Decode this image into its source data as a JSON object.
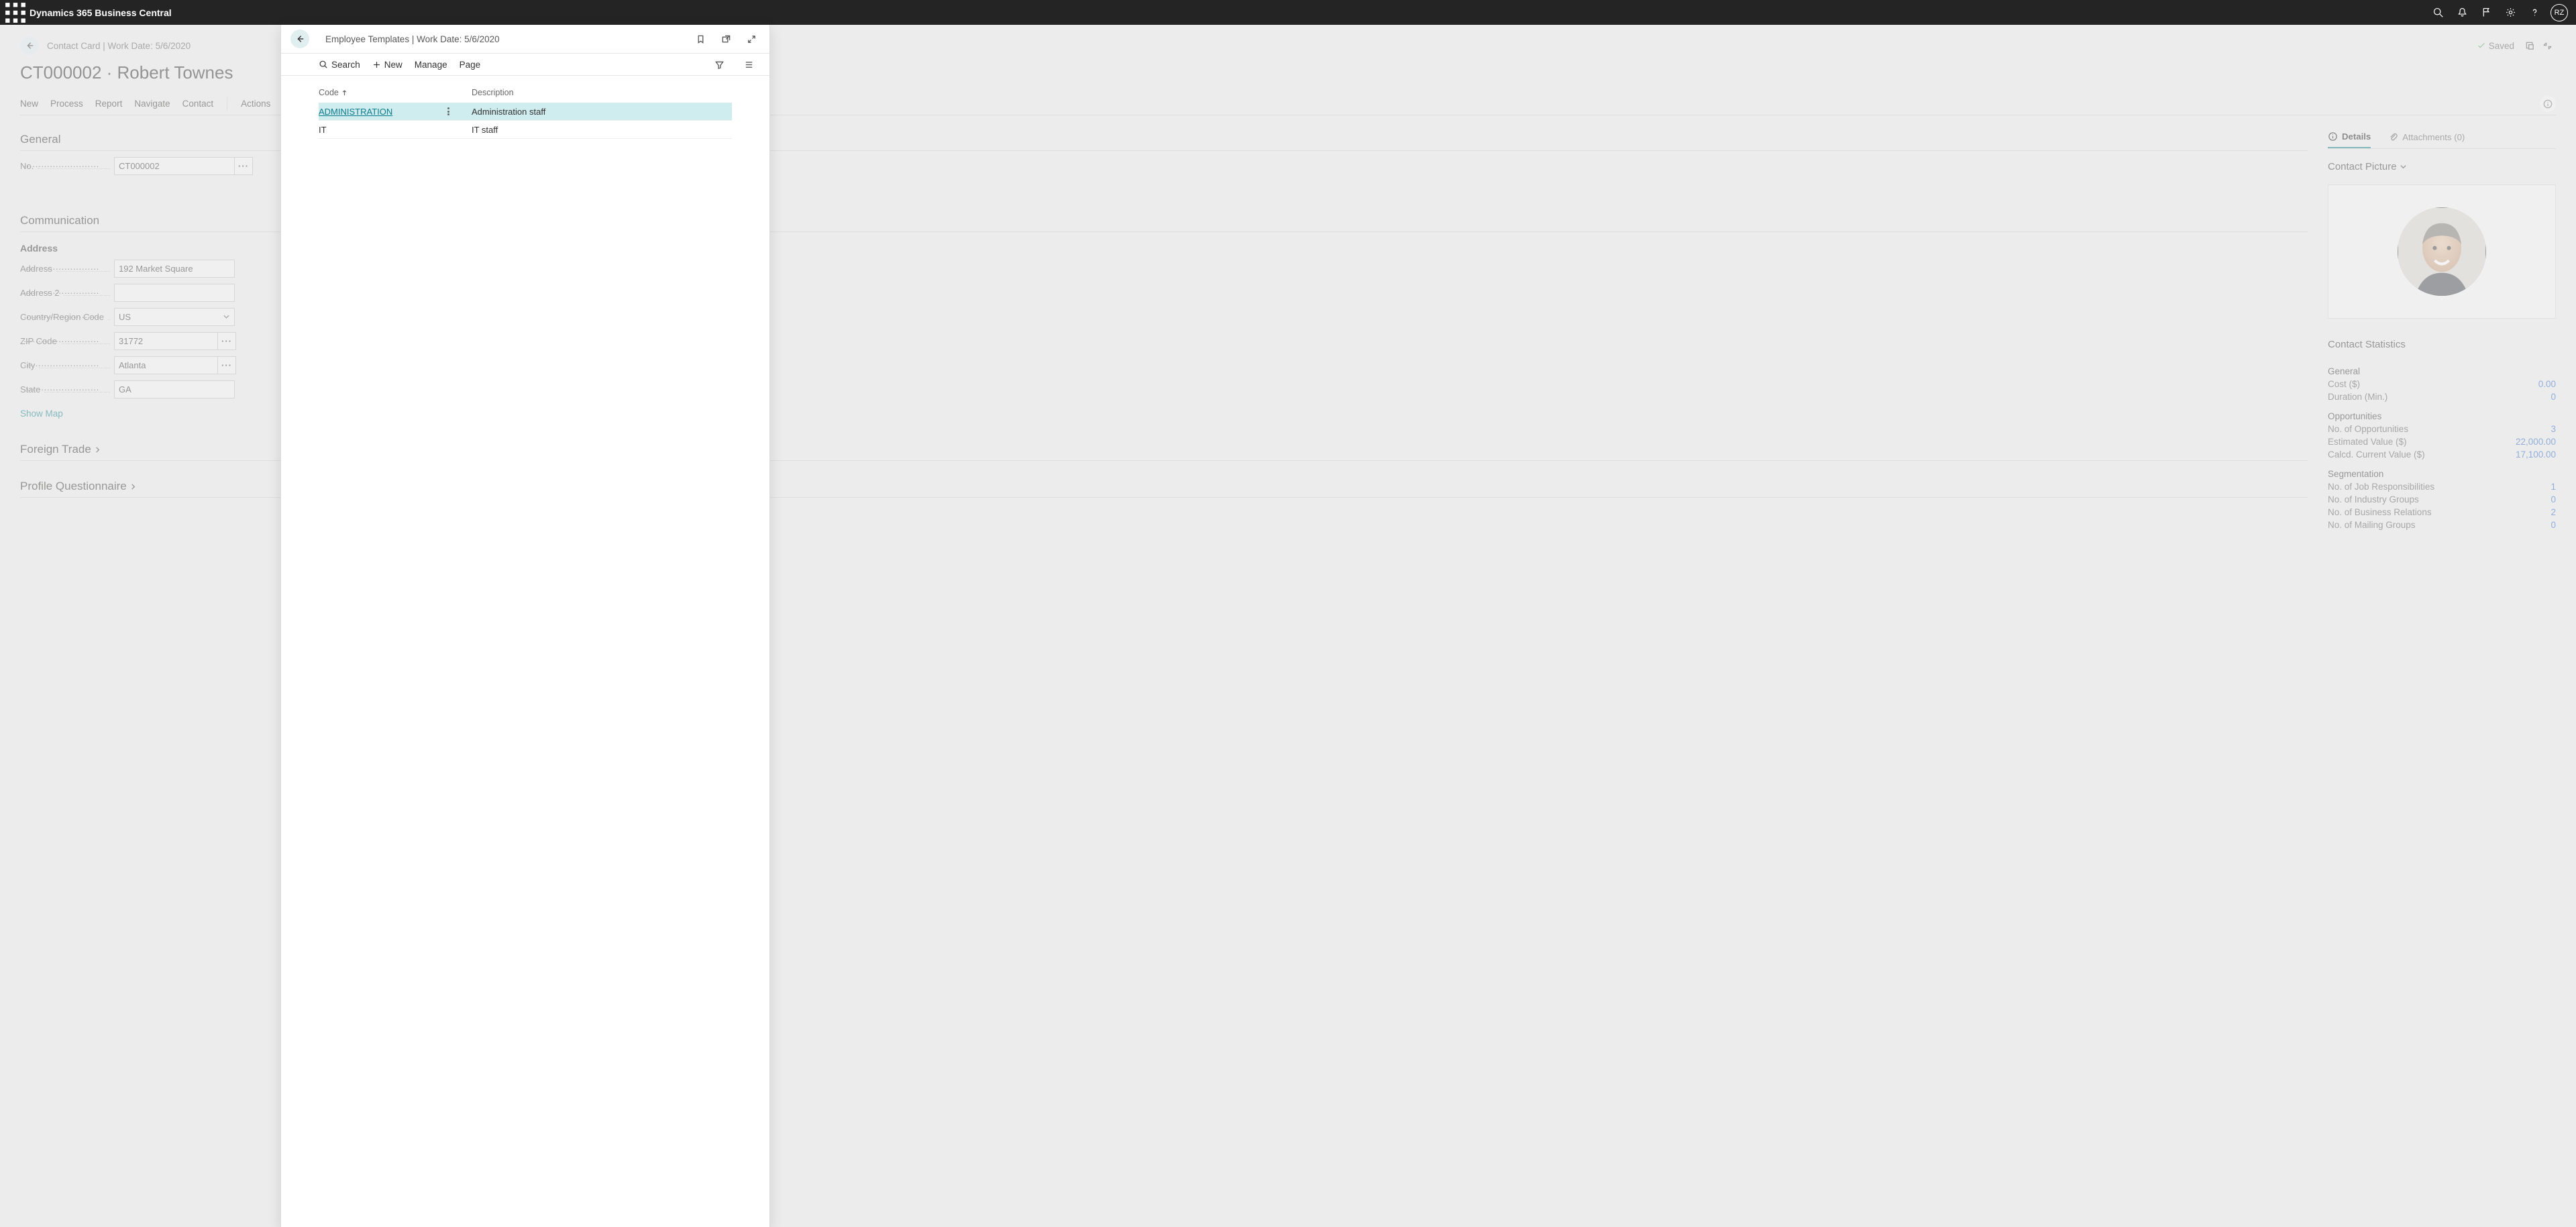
{
  "app_title": "Dynamics 365 Business Central",
  "user_initials": "RZ",
  "bg_page": {
    "crumb": "Contact Card | Work Date: 5/6/2020",
    "saved_label": "Saved",
    "title": "CT000002 · Robert Townes",
    "actions": [
      "New",
      "Process",
      "Report",
      "Navigate",
      "Contact",
      "Actions"
    ],
    "section_general": "General",
    "field_no_label": "No.",
    "field_no_value": "CT000002",
    "section_communication": "Communication",
    "address_heading": "Address",
    "addr_label": "Address",
    "addr_value": "192 Market Square",
    "addr2_label": "Address 2",
    "addr2_value": "",
    "country_label": "Country/Region Code",
    "country_value": "US",
    "zip_label": "ZIP Code",
    "zip_value": "31772",
    "city_label": "City",
    "city_value": "Atlanta",
    "state_label": "State",
    "state_value": "GA",
    "show_map": "Show Map",
    "section_foreign": "Foreign Trade",
    "section_profile": "Profile Questionnaire",
    "tab_details": "Details",
    "tab_attachments": "Attachments (0)",
    "picture_heading": "Contact Picture",
    "stats_heading": "Contact Statistics",
    "stats": {
      "general_hd": "General",
      "cost_label": "Cost ($)",
      "cost_value": "0.00",
      "duration_label": "Duration (Min.)",
      "duration_value": "0",
      "opp_hd": "Opportunities",
      "noopp_label": "No. of Opportunities",
      "noopp_value": "3",
      "est_label": "Estimated Value ($)",
      "est_value": "22,000.00",
      "calc_label": "Calcd. Current Value ($)",
      "calc_value": "17,100.00",
      "seg_hd": "Segmentation",
      "jobr_label": "No. of Job Responsibilities",
      "jobr_value": "1",
      "ind_label": "No. of Industry Groups",
      "ind_value": "0",
      "bus_label": "No. of Business Relations",
      "bus_value": "2",
      "mail_label": "No. of Mailing Groups",
      "mail_value": "0"
    }
  },
  "panel": {
    "crumb": "Employee Templates | Work Date: 5/6/2020",
    "actions": {
      "search": "Search",
      "new": "New",
      "manage": "Manage",
      "page": "Page"
    },
    "columns": {
      "code": "Code",
      "desc": "Description"
    },
    "rows": [
      {
        "code": "ADMINISTRATION",
        "desc": "Administration staff",
        "selected": true
      },
      {
        "code": "IT",
        "desc": "IT staff",
        "selected": false
      }
    ]
  }
}
